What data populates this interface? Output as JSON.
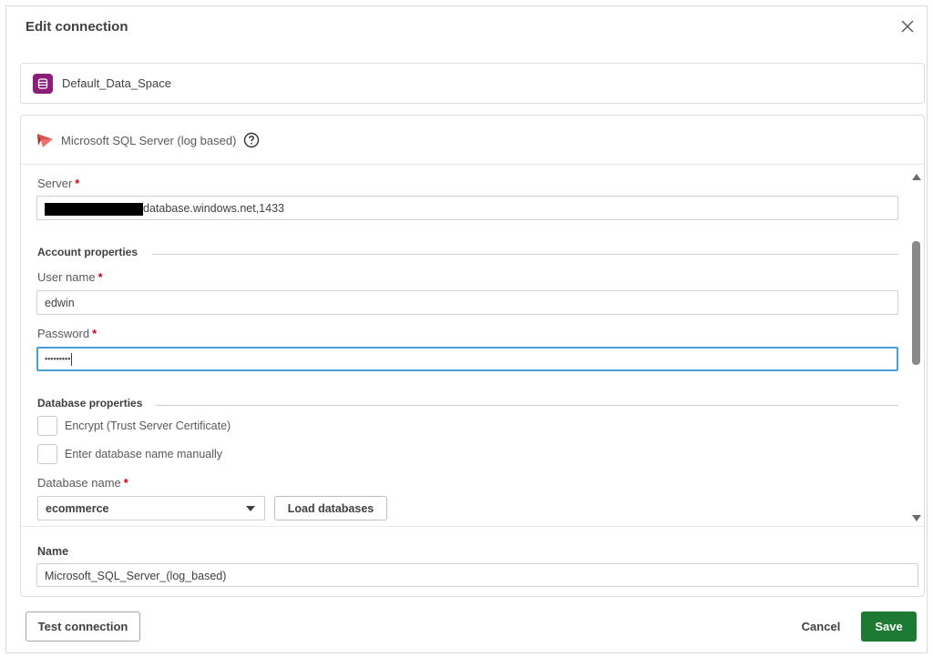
{
  "dialog": {
    "title": "Edit connection",
    "close_icon": "close-icon"
  },
  "space": {
    "name": "Default_Data_Space",
    "icon": "database-icon",
    "icon_color": "#8a1f7a"
  },
  "connector": {
    "type_label": "Microsoft SQL Server (log based)",
    "icon": "sql-server-icon",
    "help_icon": "help-circle-icon"
  },
  "server": {
    "label": "Server",
    "required_mark": "*",
    "value_suffix": "database.windows.net,1433"
  },
  "account": {
    "section_title": "Account properties",
    "username_label": "User name",
    "username_value": "edwin",
    "password_label": "Password",
    "password_value": "•••••••••",
    "required_mark": "*"
  },
  "database": {
    "section_title": "Database properties",
    "encrypt_label": "Encrypt (Trust Server Certificate)",
    "encrypt_checked": false,
    "manual_label": "Enter database name manually",
    "manual_checked": false,
    "dbname_label": "Database name",
    "required_mark": "*",
    "dbname_selected": "ecommerce",
    "load_button": "Load databases"
  },
  "name_field": {
    "label": "Name",
    "value": "Microsoft_SQL_Server_(log_based)"
  },
  "footer": {
    "test_button": "Test connection",
    "cancel_button": "Cancel",
    "save_button": "Save",
    "save_color": "#1d7a33"
  },
  "colors": {
    "focus_border": "#4a9fd8",
    "required": "#d0021b"
  }
}
